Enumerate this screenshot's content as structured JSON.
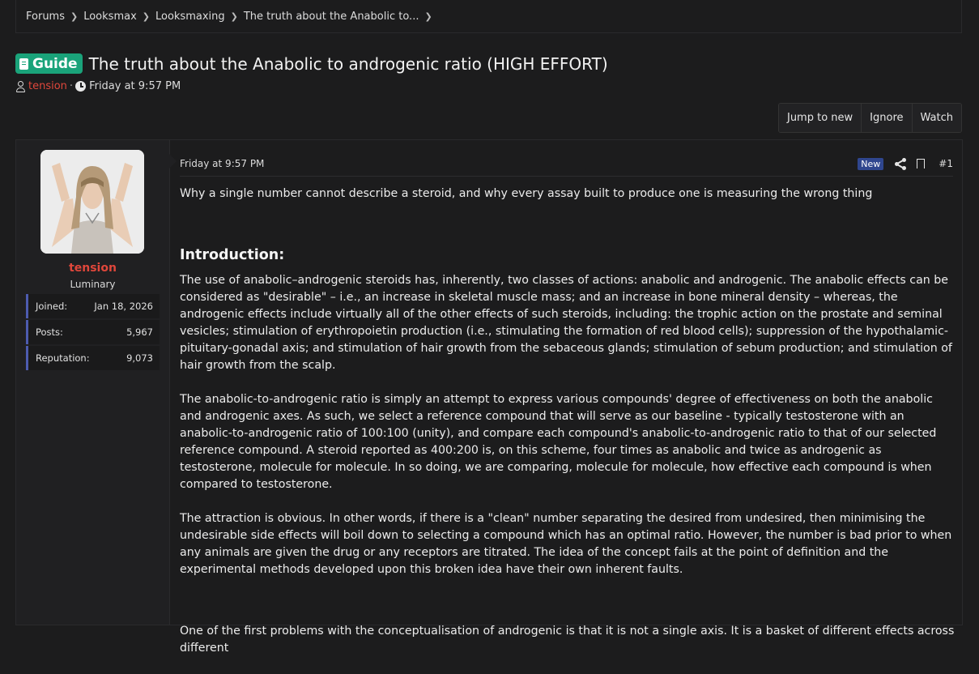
{
  "breadcrumb": {
    "items": [
      "Forums",
      "Looksmax",
      "Looksmaxing",
      "The truth about the Anabolic to..."
    ]
  },
  "thread": {
    "badge": "Guide",
    "title": "The truth about the Anabolic to androgenic ratio (HIGH EFFORT)",
    "author": "tension",
    "separator": "·",
    "date": "Friday at 9:57 PM"
  },
  "actions": {
    "jump": "Jump to new",
    "ignore": "Ignore",
    "watch": "Watch"
  },
  "post": {
    "user": {
      "name": "tension",
      "title": "Luminary",
      "stats": [
        {
          "label": "Joined:",
          "value": "Jan 18, 2026"
        },
        {
          "label": "Posts:",
          "value": "5,967"
        },
        {
          "label": "Reputation:",
          "value": "9,073"
        }
      ]
    },
    "date": "Friday at 9:57 PM",
    "new_badge": "New",
    "number": "#1",
    "lead": "Why a single number cannot describe a steroid, and why every assay built to produce one is measuring the wrong thing",
    "heading": "Introduction:",
    "paragraphs": [
      "The use of anabolic–androgenic steroids has, inherently, two classes of actions: anabolic and androgenic. The anabolic effects can be considered as \"desirable\" – i.e., an increase in skeletal muscle mass; and an increase in bone mineral density – whereas, the androgenic effects include virtually all of the other effects of such steroids, including: the trophic action on the prostate and seminal vesicles; stimulation of erythropoietin production (i.e., stimulating the formation of red blood cells); suppression of the hypothalamic-pituitary-gonadal axis; and stimulation of hair growth from the sebaceous glands; stimulation of sebum production; and stimulation of hair growth from the scalp.",
      "The anabolic-to-androgenic ratio is simply an attempt to express various compounds' degree of effectiveness on both the anabolic and androgenic axes. As such, we select a reference compound that will serve as our baseline - typically testosterone with an anabolic-to-androgenic ratio of 100:100 (unity), and compare each compound's anabolic-to-androgenic ratio to that of our selected reference compound. A steroid reported as 400:200 is, on this scheme, four times as anabolic and twice as androgenic as testosterone, molecule for molecule. In so doing, we are comparing, molecule for molecule, how effective each compound is when compared to testosterone.",
      "The attraction is obvious. In other words, if there is a \"clean\" number separating the desired from undesired, then minimising the undesirable side effects will boil down to selecting a compound which has an optimal ratio. However, the number is bad prior to when any animals are given the drug or any receptors are titrated. The idea of the concept fails at the point of definition and the experimental methods developed upon this broken idea have their own inherent faults.",
      "One of the first problems with the conceptualisation of androgenic is that it is not a single axis. It is a basket of different effects across different"
    ]
  },
  "colors": {
    "background": "#1c1c1d",
    "accent_guide": "#1aa37a",
    "author": "#e0473b",
    "new_badge": "#2f468e",
    "stat_border": "#4d5bb0"
  }
}
